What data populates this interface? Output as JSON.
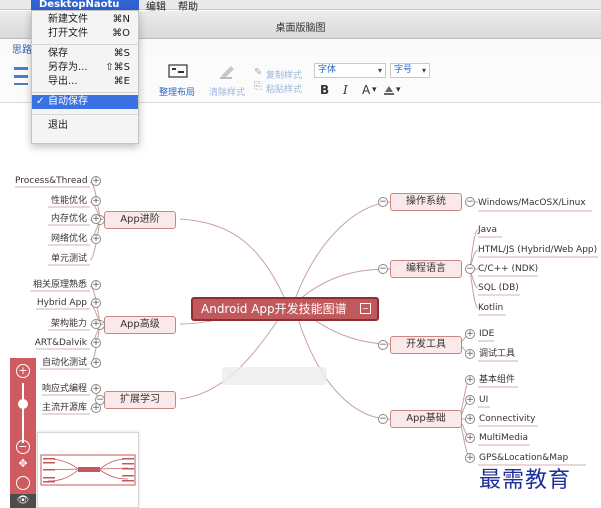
{
  "menubar": {
    "app_name": "DesktopNaotu",
    "items": [
      "编辑",
      "帮助"
    ]
  },
  "menu": {
    "items": [
      {
        "label": "新建文件",
        "shortcut": "⌘N"
      },
      {
        "label": "打开文件",
        "shortcut": "⌘O"
      },
      {
        "label": "保存",
        "shortcut": "⌘S"
      },
      {
        "label": "另存为...",
        "shortcut": "⇧⌘S"
      },
      {
        "label": "导出...",
        "shortcut": "⌘E"
      },
      {
        "label": "自动保存",
        "shortcut": "",
        "checked": true,
        "check_mark": "✓"
      },
      {
        "label": "退出",
        "shortcut": ""
      }
    ]
  },
  "window": {
    "title": "桌面版脑图"
  },
  "tabs": {
    "active": "思路"
  },
  "toolbar": {
    "organize_label": "整理布局",
    "clear_style_label": "清除样式",
    "copy_style_label": "复制样式",
    "paste_style_label": "粘贴样式",
    "font_value": "字体",
    "size_value": "字号",
    "bold": "B",
    "italic": "I",
    "font_color": "A",
    "dropdown_arrow": "▾"
  },
  "mindmap": {
    "root": "Android App开发技能图谱",
    "collapse_mark": "−",
    "expand_mark": "+",
    "left": [
      {
        "label": "App进阶",
        "children": [
          "Process&Thread",
          "性能优化",
          "内存优化",
          "网络优化",
          "单元测试"
        ]
      },
      {
        "label": "App高级",
        "children": [
          "相关原理熟悉",
          "Hybrid App",
          "架构能力",
          "ART&Dalvik",
          "自动化测试"
        ]
      },
      {
        "label": "扩展学习",
        "children": [
          "响应式编程",
          "主流开源库"
        ]
      }
    ],
    "right": [
      {
        "label": "操作系统",
        "children": [
          "Windows/MacOSX/Linux"
        ]
      },
      {
        "label": "编程语言",
        "children": [
          "Java",
          "HTML/JS (Hybrid/Web App)",
          "C/C++ (NDK)",
          "SQL (DB)",
          "Kotlin"
        ]
      },
      {
        "label": "开发工具",
        "children": [
          "IDE",
          "调试工具"
        ]
      },
      {
        "label": "App基础",
        "children": [
          "基本组件",
          "UI",
          "Connectivity",
          "MultiMedia",
          "GPS&Location&Map"
        ]
      }
    ]
  },
  "zoom": {
    "in": "+",
    "out": "−",
    "move": "✥",
    "eye": "👁"
  },
  "watermark": "最需教育"
}
